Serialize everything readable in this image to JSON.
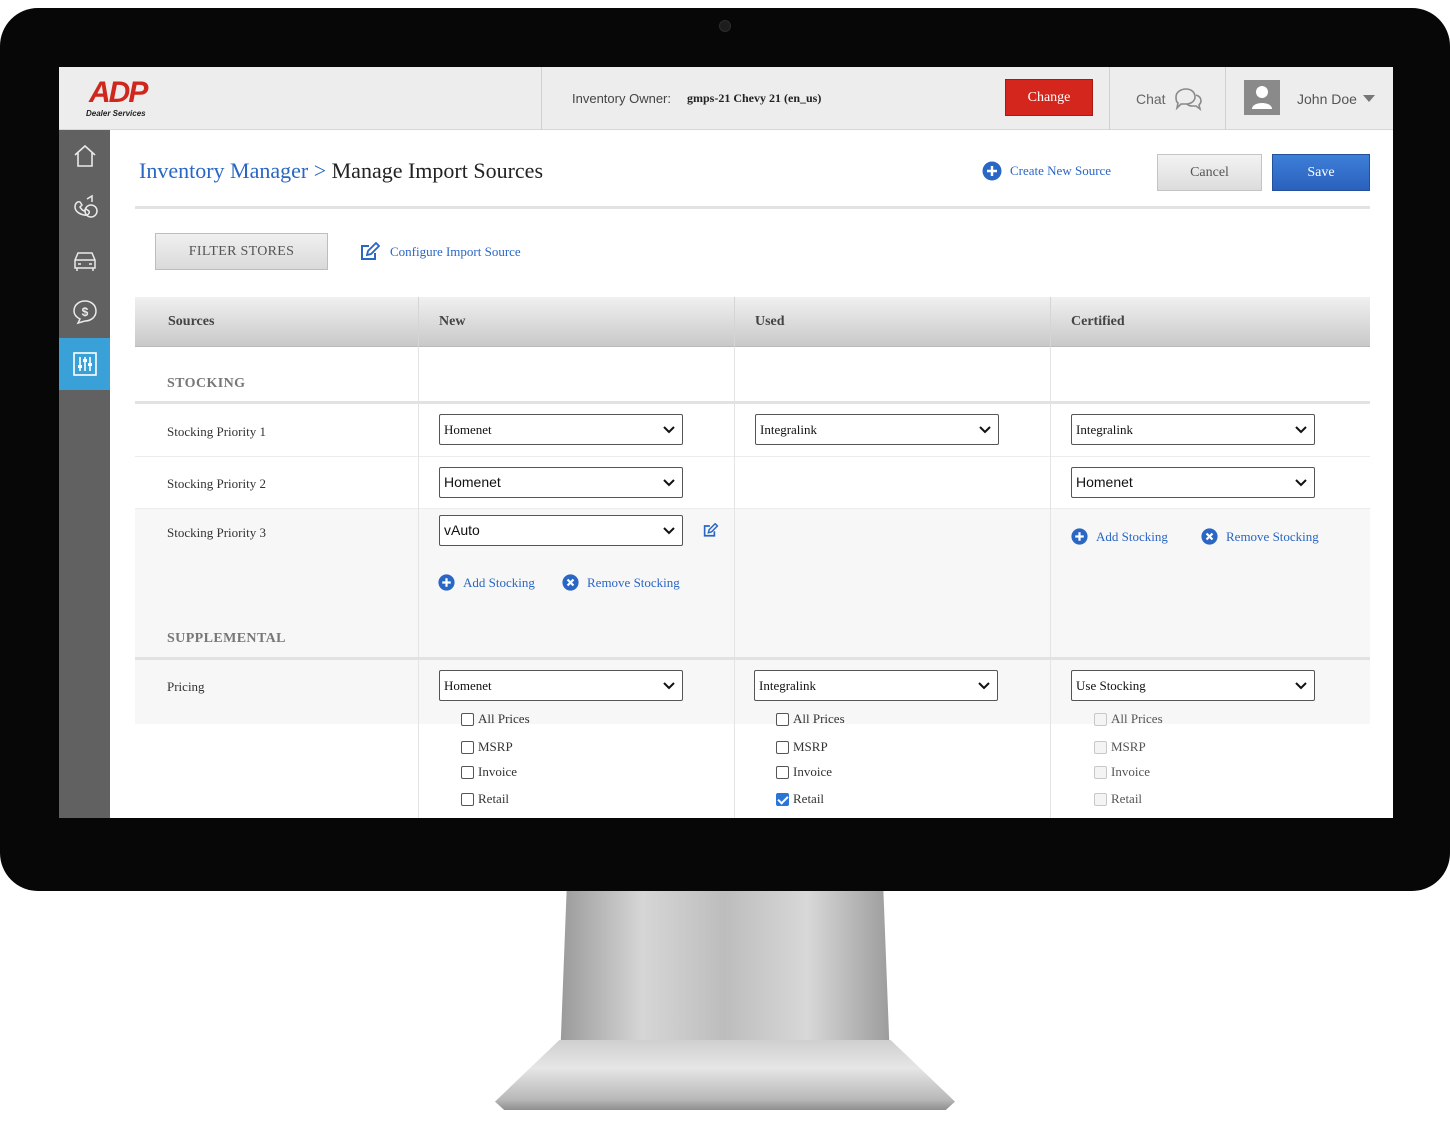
{
  "header": {
    "logo_text": "ADP",
    "logo_sub": "Dealer Services",
    "owner_label": "Inventory Owner:",
    "owner_value": "gmps-21 Chevy 21 (en_us)",
    "change_label": "Change",
    "chat_label": "Chat",
    "user_name": "John Doe"
  },
  "sidebar": {
    "items": [
      {
        "icon": "home-icon"
      },
      {
        "icon": "phone-chat-icon"
      },
      {
        "icon": "car-icon"
      },
      {
        "icon": "dollar-chat-icon"
      },
      {
        "icon": "sliders-icon",
        "active": true
      }
    ]
  },
  "page": {
    "breadcrumb": "Inventory Manager >",
    "title": "Manage Import Sources",
    "create_label": "Create New Source",
    "cancel_label": "Cancel",
    "save_label": "Save",
    "filter_label": "FILTER STORES",
    "configure_label": "Configure Import Source"
  },
  "table": {
    "columns": [
      "Sources",
      "New",
      "Used",
      "Certified"
    ],
    "stocking_section": "STOCKING",
    "supplemental_section": "SUPPLEMENTAL",
    "rows": {
      "p1": {
        "label": "Stocking Priority 1",
        "new": "Homenet",
        "used": "Integralink",
        "certified": "Integralink"
      },
      "p2": {
        "label": "Stocking Priority 2",
        "new": "Homenet",
        "certified": "Homenet"
      },
      "p3": {
        "label": "Stocking Priority 3",
        "new": "vAuto"
      }
    },
    "add_stocking": "Add Stocking",
    "remove_stocking": "Remove Stocking",
    "pricing": {
      "label": "Pricing",
      "new": "Homenet",
      "used": "Integralink",
      "certified": "Use Stocking"
    },
    "price_options": [
      "All Prices",
      "MSRP",
      "Invoice",
      "Retail"
    ],
    "used_checked": "Retail",
    "colors": {
      "accent": "#2a66c4",
      "danger": "#d4261d",
      "sidebar_active": "#3aa0d8"
    }
  }
}
